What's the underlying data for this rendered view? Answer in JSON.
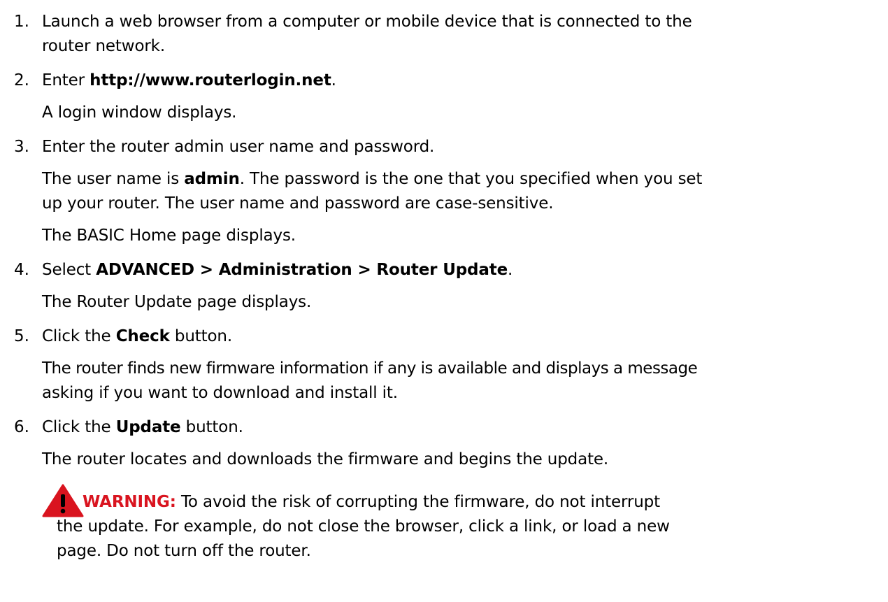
{
  "steps": [
    {
      "num": "1.",
      "lines": [
        "Launch a web browser from a computer or mobile device that is connected to the",
        "router network."
      ]
    },
    {
      "num": "2.",
      "pre": "Enter ",
      "bold": "http://www.routerlogin.net",
      "post": ".",
      "result": "A login window displays."
    },
    {
      "num": "3.",
      "text": "Enter the router admin user name and password.",
      "detail_pre": "The user name is ",
      "detail_bold": "admin",
      "detail_post": ". The password is the one that you specified when you set",
      "detail_line2": "up your router. The user name and password are case-sensitive.",
      "result": "The BASIC Home page displays."
    },
    {
      "num": "4.",
      "pre": "Select ",
      "bold": "ADVANCED > Administration > Router Update",
      "post": ".",
      "result": "The Router Update page displays."
    },
    {
      "num": "5.",
      "pre": "Click the ",
      "bold": "Check",
      "post": " button.",
      "result_lines": [
        "The router finds new firmware information if any is available and displays a message",
        "asking if you want to download and install it."
      ]
    },
    {
      "num": "6.",
      "pre": "Click the ",
      "bold": "Update",
      "post": " button.",
      "result": "The router locates and downloads the firmware and begins the update."
    }
  ],
  "warning": {
    "icon": "warning-triangle-icon",
    "color": "#d9141f",
    "label": "WARNING:",
    "lines": [
      " To avoid the risk of corrupting the firmware, do not interrupt",
      "the update. For example, do not close the browser, click a link, or load a new",
      "page. Do not turn off the router."
    ]
  }
}
